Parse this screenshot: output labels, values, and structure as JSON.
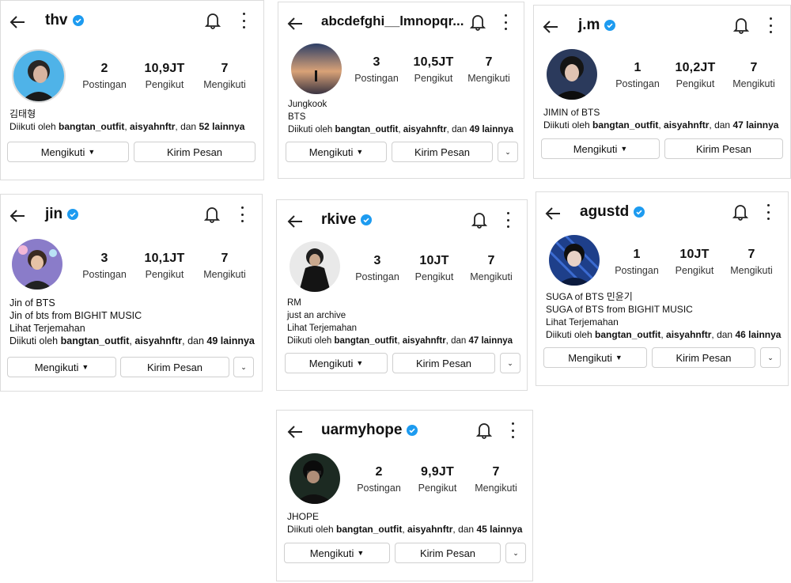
{
  "ui": {
    "following_label": "Mengikuti",
    "message_label": "Kirim Pesan",
    "posts_label": "Postingan",
    "followers_label": "Pengikut",
    "following_count_label": "Mengikuti",
    "followed_prefix": "Diikuti oleh",
    "mutual_1": "bangtan_outfit",
    "mutual_2": "aisyahnftr",
    "and_word": "dan"
  },
  "colors": {
    "verified": "#1d9bf0",
    "text": "#111111",
    "border": "#dcdcdc"
  },
  "profiles": [
    {
      "username": "thv",
      "verified": true,
      "posts": "2",
      "followers": "10,9JT",
      "following": "7",
      "bio": [
        "김태형"
      ],
      "others": "52 lainnya",
      "dropdown": false
    },
    {
      "username": "abcdefghi__lmnopqr...",
      "verified": false,
      "posts": "3",
      "followers": "10,5JT",
      "following": "7",
      "bio": [
        "Jungkook",
        "BTS"
      ],
      "others": "49 lainnya",
      "dropdown": true
    },
    {
      "username": "j.m",
      "verified": true,
      "posts": "1",
      "followers": "10,2JT",
      "following": "7",
      "bio": [
        "JIMIN of BTS"
      ],
      "others": "47 lainnya",
      "dropdown": false
    },
    {
      "username": "jin",
      "verified": true,
      "posts": "3",
      "followers": "10,1JT",
      "following": "7",
      "bio": [
        "Jin of BTS",
        "Jin of bts from BIGHIT MUSIC",
        "Lihat Terjemahan"
      ],
      "others": "49 lainnya",
      "dropdown": true
    },
    {
      "username": "rkive",
      "verified": true,
      "posts": "3",
      "followers": "10JT",
      "following": "7",
      "bio": [
        "RM",
        "just an archive",
        "Lihat Terjemahan"
      ],
      "others": "47 lainnya",
      "dropdown": true
    },
    {
      "username": "agustd",
      "verified": true,
      "posts": "1",
      "followers": "10JT",
      "following": "7",
      "bio": [
        "SUGA of BTS 민윤기",
        "SUGA of BTS from BIGHIT MUSIC",
        "Lihat Terjemahan"
      ],
      "others": "46 lainnya",
      "dropdown": true
    },
    {
      "username": "uarmyhope",
      "verified": true,
      "posts": "2",
      "followers": "9,9JT",
      "following": "7",
      "bio": [
        "JHOPE"
      ],
      "others": "45 lainnya",
      "dropdown": true
    }
  ]
}
